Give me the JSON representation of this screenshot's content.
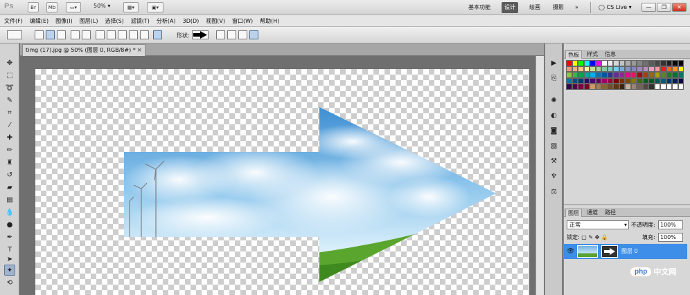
{
  "appbar": {
    "logo": "Ps",
    "br_label": "Br",
    "mb_label": "Mb",
    "zoom": "50%",
    "workspaces": [
      "基本功能",
      "设计",
      "绘画",
      "摄影"
    ],
    "active_workspace": "设计",
    "more": "»",
    "cslive": "CS Live"
  },
  "menus": [
    "文件(F)",
    "编辑(E)",
    "图像(I)",
    "图层(L)",
    "选择(S)",
    "滤镜(T)",
    "分析(A)",
    "3D(D)",
    "视图(V)",
    "窗口(W)",
    "帮助(H)"
  ],
  "options": {
    "shape_label": "形状:"
  },
  "document": {
    "tab_title": "timg (17).jpg @ 50% (图层 0, RGB/8#) *",
    "close": "×"
  },
  "swatch_panel": {
    "tabs": [
      "色板",
      "样式",
      "信息"
    ],
    "active_tab": "色板",
    "colors": [
      "#ff0000",
      "#ffff00",
      "#00ff00",
      "#00ffff",
      "#0000ff",
      "#ff00ff",
      "#ffffff",
      "#ebebeb",
      "#d6d6d6",
      "#c2c2c2",
      "#adadad",
      "#999999",
      "#858585",
      "#707070",
      "#5c5c5c",
      "#474747",
      "#333333",
      "#1f1f1f",
      "#0a0a0a",
      "#000000",
      "#f7977a",
      "#f9ad81",
      "#fdc68a",
      "#fff79a",
      "#c4df9b",
      "#a2d39c",
      "#82ca9d",
      "#7bcdc8",
      "#6ecff6",
      "#7ea7d8",
      "#8493ca",
      "#8882be",
      "#a187be",
      "#bc8dbf",
      "#f49ac2",
      "#f6989d",
      "#ed1c24",
      "#f26522",
      "#f7941d",
      "#fff200",
      "#8dc63f",
      "#39b54a",
      "#00a651",
      "#00a99d",
      "#00aeef",
      "#0072bc",
      "#0054a6",
      "#2e3192",
      "#662d91",
      "#92278f",
      "#ec008c",
      "#ed145b",
      "#9e0b0f",
      "#a0410d",
      "#a36209",
      "#aba000",
      "#598527",
      "#1a7b30",
      "#007236",
      "#00746b",
      "#0076a3",
      "#004b80",
      "#003471",
      "#1b1464",
      "#440e62",
      "#630460",
      "#9e005d",
      "#9e0039",
      "#790000",
      "#7b2e00",
      "#7d4900",
      "#827b00",
      "#406618",
      "#005e20",
      "#005826",
      "#005952",
      "#005b7f",
      "#003663",
      "#002157",
      "#0d004c",
      "#32004b",
      "#4b0049",
      "#7b0046",
      "#7a0026",
      "#c69c6d",
      "#a67c52",
      "#8c6239",
      "#754c24",
      "#603913",
      "#3c2415",
      "#c7b299",
      "#998675",
      "#736357",
      "#534741",
      "#362f2d",
      "#ffffff",
      "#ffffff",
      "#ffffff",
      "#ffffff",
      "#ffffff"
    ]
  },
  "layers_panel": {
    "tabs": [
      "图层",
      "通道",
      "路径"
    ],
    "active_tab": "图层",
    "blend_mode": "正常",
    "opacity_label": "不透明度:",
    "opacity": "100%",
    "lock_label": "锁定:",
    "fill_label": "填充:",
    "fill": "100%",
    "layers": [
      {
        "name": "图层 0",
        "visible": true,
        "selected": true
      }
    ]
  },
  "watermark": {
    "logo": "php",
    "text": "中文网"
  },
  "colors": {
    "selection_blue": "#3d8ee8",
    "active_workspace_bg": "#5b5b5b"
  }
}
